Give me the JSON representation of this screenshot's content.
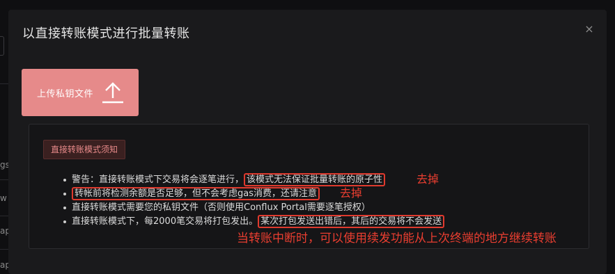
{
  "background": {
    "fragments": [
      "gs",
      "w",
      "ap",
      "ap"
    ]
  },
  "modal": {
    "title": "以直接转账模式进行批量转账",
    "close_glyph": "×",
    "upload_button": {
      "label": "上传私钥文件"
    },
    "notice": {
      "tag": "直接转账模式须知",
      "items": [
        {
          "text": "警告：直接转账模式下交易将会逐笔进行，",
          "highlight": "该模式无法保证批量转账的原子性"
        },
        {
          "highlight": "转帐前将检测余额是否足够，但不会考虑gas消费，还请注意"
        },
        {
          "text": "直接转账模式需要您的私钥文件（否则使用Conflux Portal需要逐笔授权）"
        },
        {
          "text": "直接转账模式下，每2000笔交易将打包发出。",
          "highlight": "某次打包发送出错后，其后的交易将不会发送"
        }
      ]
    }
  },
  "annotations": {
    "remove_1": "去掉",
    "remove_2": "去掉",
    "resume_note": "当转账中断时，可以使用续发功能从上次终端的地方继续转账"
  },
  "colors": {
    "accent_pink": "#e68a8a",
    "annotation_red": "#ea3e30",
    "modal_bg": "#1a1a1c"
  }
}
